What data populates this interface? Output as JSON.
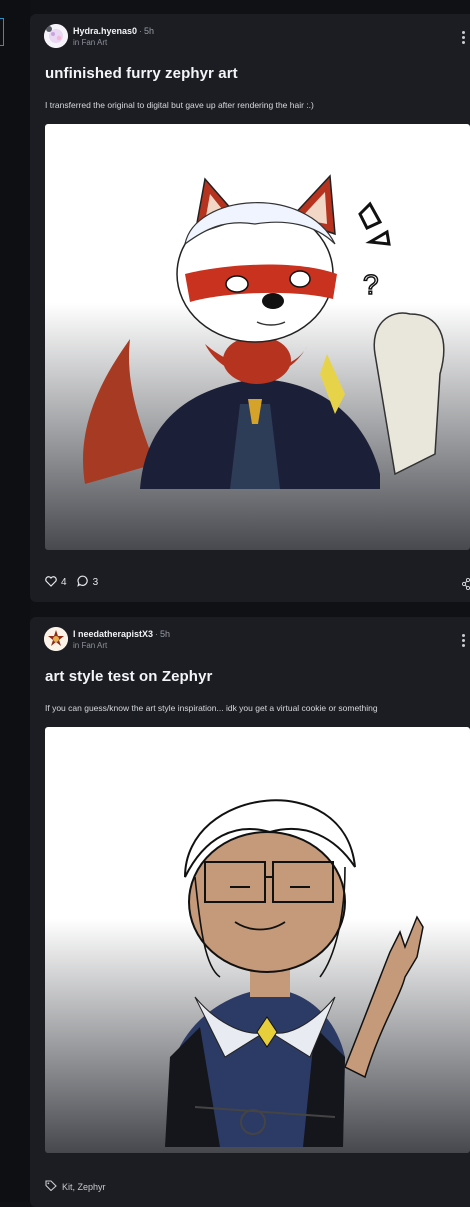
{
  "posts": [
    {
      "author": "Hydra.hyenas0",
      "time": "5h",
      "community": "in Fan Art",
      "title": "unfinished furry zephyr art",
      "body": "I transferred the original to digital but gave up after rendering the hair :.)",
      "likes": "4",
      "comments": "3",
      "image_icon": "fan-art-image"
    },
    {
      "author": "I needatherapistX3",
      "time": "5h",
      "community": "in Fan Art",
      "title": "art style test on Zephyr",
      "body": "If you can guess/know the art style inspiration... idk you get a virtual cookie or something",
      "tags": "Kit, Zephyr",
      "image_icon": "fan-art-image"
    }
  ],
  "colors": {
    "page_bg": "#0f1115",
    "card_bg": "#1b1d22",
    "accent": "#2b90c7"
  }
}
